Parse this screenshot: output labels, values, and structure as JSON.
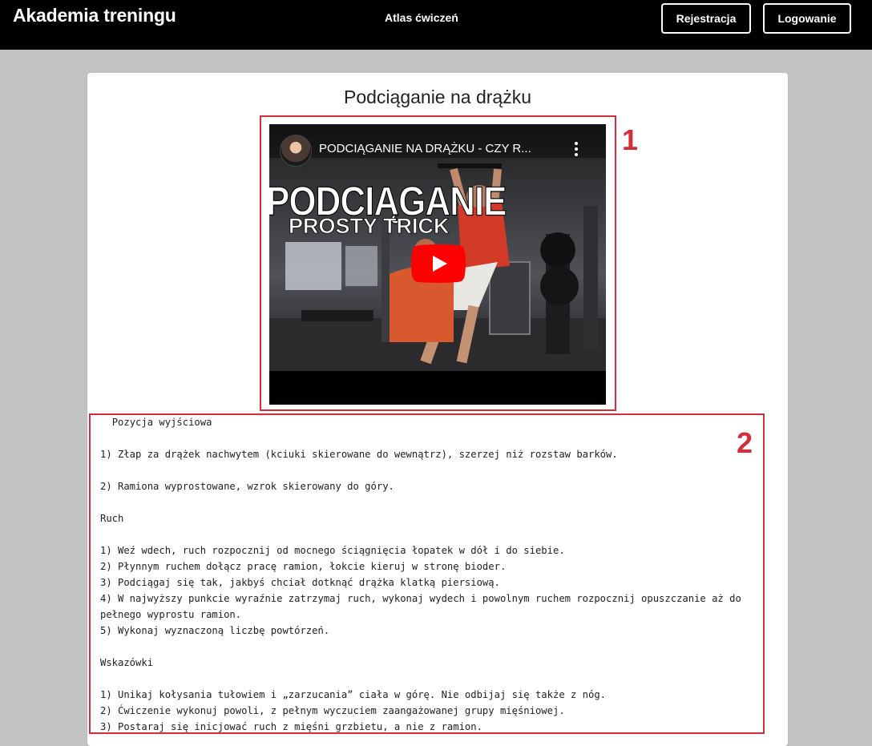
{
  "navbar": {
    "brand": "Akademia treningu",
    "atlas_link": "Atlas ćwiczeń",
    "register_label": "Rejestracja",
    "login_label": "Logowanie"
  },
  "exercise": {
    "title": "Podciąganie na drążku"
  },
  "video": {
    "title": "PODCIĄGANIE NA DRĄŻKU - CZY R...",
    "thumbnail_headline": "PODCIĄGANIE",
    "thumbnail_subline": "PROSTY TRICK",
    "play_icon": "play-icon",
    "menu_icon": "kebab-menu-icon",
    "play_color": "#ff0000"
  },
  "annotations": {
    "label_1": "1",
    "label_2": "2",
    "color": "#d22f3a"
  },
  "description": {
    "text": "  Pozycja wyjściowa\n\n1) Złap za drążek nachwytem (kciuki skierowane do wewnątrz), szerzej niż rozstaw barków.\n\n2) Ramiona wyprostowane, wzrok skierowany do góry.\n\nRuch\n\n1) Weź wdech, ruch rozpocznij od mocnego ściągnięcia łopatek w dół i do siebie.\n2) Płynnym ruchem dołącz pracę ramion, łokcie kieruj w stronę bioder.\n3) Podciągaj się tak, jakbyś chciał dotknąć drążka klatką piersiową.\n4) W najwyższy punkcie wyraźnie zatrzymaj ruch, wykonaj wydech i powolnym ruchem rozpocznij opuszczanie aż do pełnego wyprostu ramion.\n5) Wykonaj wyznaczoną liczbę powtórzeń.\n\nWskazówki\n\n1) Unikaj kołysania tułowiem i „zarzucania” ciała w górę. Nie odbijaj się także z nóg.\n2) Ćwiczenie wykonuj powoli, z pełnym wyczuciem zaangażowanej grupy mięśniowej.\n3) Postaraj się inicjować ruch z mięśni grzbietu, a nie z ramion."
  }
}
